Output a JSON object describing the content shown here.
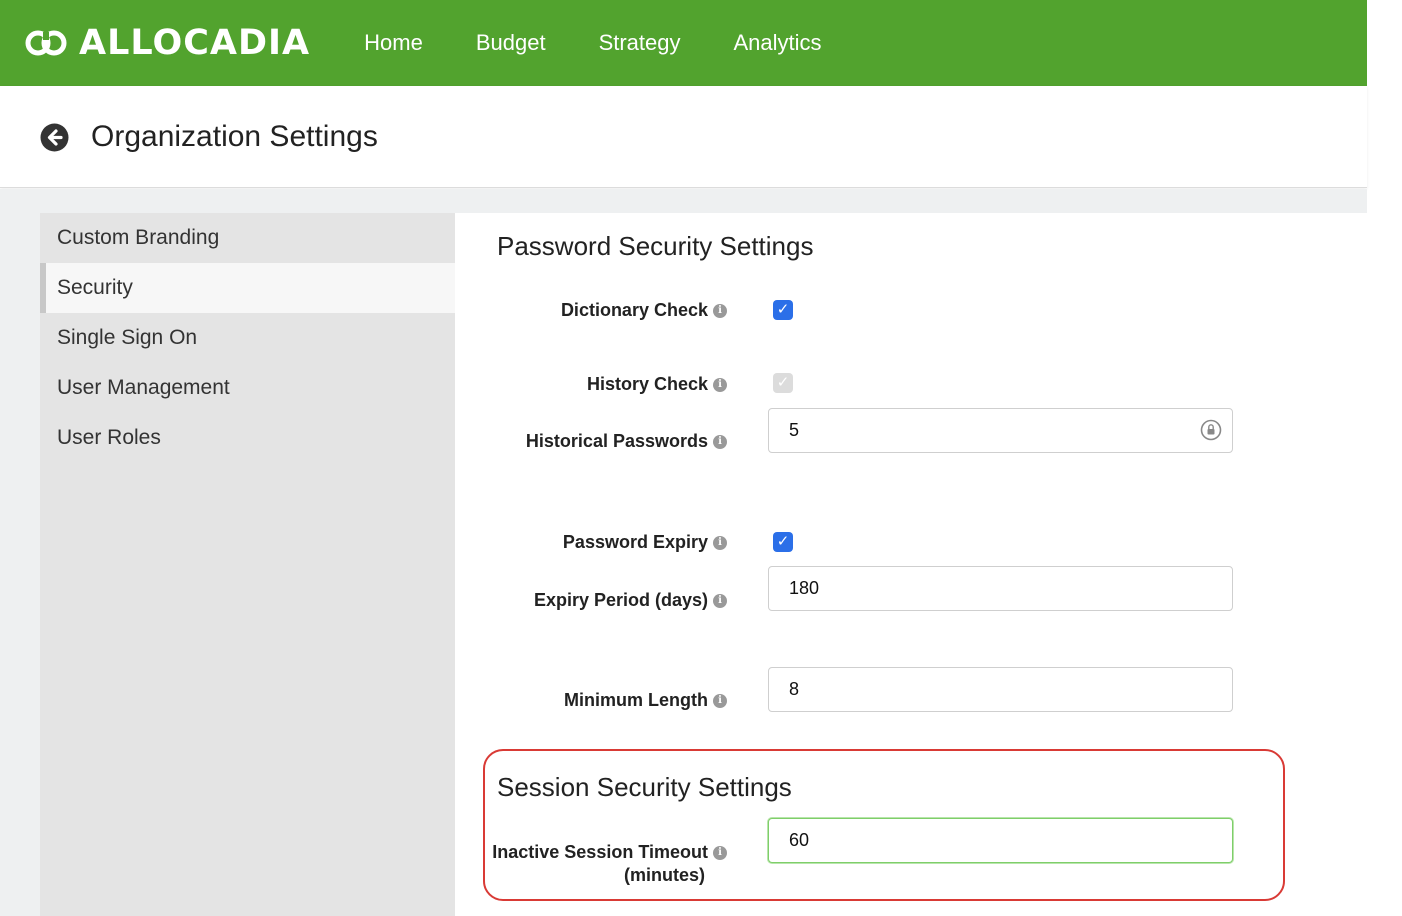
{
  "brand": {
    "name": "ALLOCADIA",
    "color": "#52a32e"
  },
  "nav": {
    "items": [
      "Home",
      "Budget",
      "Strategy",
      "Analytics"
    ]
  },
  "header": {
    "title": "Organization Settings",
    "back_icon": "arrow-left-circle-icon"
  },
  "sidebar": {
    "items": [
      {
        "label": "Custom Branding"
      },
      {
        "label": "Security",
        "active": true
      },
      {
        "label": "Single Sign On"
      },
      {
        "label": "User Management"
      },
      {
        "label": "User Roles"
      }
    ]
  },
  "password": {
    "title": "Password Security Settings",
    "dictionary_check": {
      "label": "Dictionary Check",
      "checked": true
    },
    "history_check": {
      "label": "History Check",
      "checked": true,
      "disabled": true
    },
    "historical_passwords": {
      "label": "Historical Passwords",
      "value": "5"
    },
    "password_expiry": {
      "label": "Password Expiry",
      "checked": true
    },
    "expiry_period": {
      "label": "Expiry Period (days)",
      "value": "180"
    },
    "minimum_length": {
      "label": "Minimum Length",
      "value": "8"
    }
  },
  "session": {
    "title": "Session Security Settings",
    "timeout": {
      "label_line1": "Inactive Session Timeout",
      "label_line2": "(minutes)",
      "value": "60"
    }
  },
  "colors": {
    "checkbox": "#2b6fe8",
    "highlight": "#d93a35",
    "focus_border": "#7fce6a"
  }
}
